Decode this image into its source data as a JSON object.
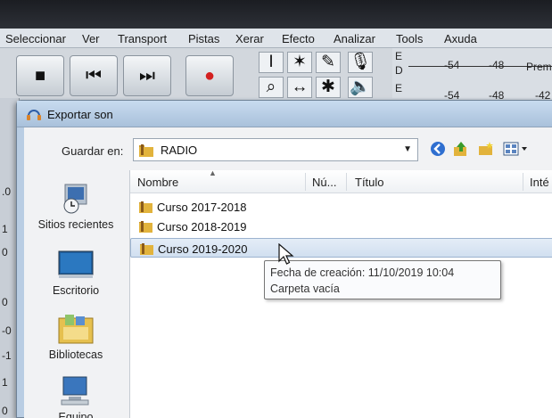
{
  "app_menu": {
    "items": [
      "Seleccionar",
      "Ver",
      "Transport",
      "Pistas",
      "Xerar",
      "Efecto",
      "Analizar",
      "Tools",
      "Axuda"
    ]
  },
  "meter": {
    "channel_top": "E",
    "channel_mid": "D",
    "channel_bottom": "E",
    "tick_54": "-54",
    "tick_48": "-48",
    "tick_48b": "-48",
    "tick_54b": "-54",
    "tick_42": "-42",
    "label_prem": "Prem"
  },
  "ruler": {
    "labels": [
      ".0",
      "1",
      "0",
      "0",
      "-0",
      "-1",
      "1",
      "0"
    ]
  },
  "dialog": {
    "title": "Exportar son",
    "save_in_label": "Guardar en:",
    "save_in_value": "RADIO"
  },
  "places": [
    {
      "label": "Sitios recientes",
      "icon": "recent-places-icon"
    },
    {
      "label": "Escritorio",
      "icon": "desktop-icon"
    },
    {
      "label": "Bibliotecas",
      "icon": "libraries-icon"
    },
    {
      "label": "Equipo",
      "icon": "computer-icon"
    }
  ],
  "file_list": {
    "columns": [
      "Nombre",
      "Nú...",
      "Título",
      "Inté"
    ],
    "rows": [
      {
        "name": "Curso 2017-2018",
        "selected": false
      },
      {
        "name": "Curso 2018-2019",
        "selected": false
      },
      {
        "name": "Curso 2019-2020",
        "selected": true
      }
    ]
  },
  "tooltip": {
    "line1": "Fecha de creación: 11/10/2019 10:04",
    "line2": "Carpeta vacía"
  },
  "colors": {
    "dialog_frame": "#b9cde3",
    "selection": "#d1dff0",
    "folder": "#e2b33c"
  }
}
